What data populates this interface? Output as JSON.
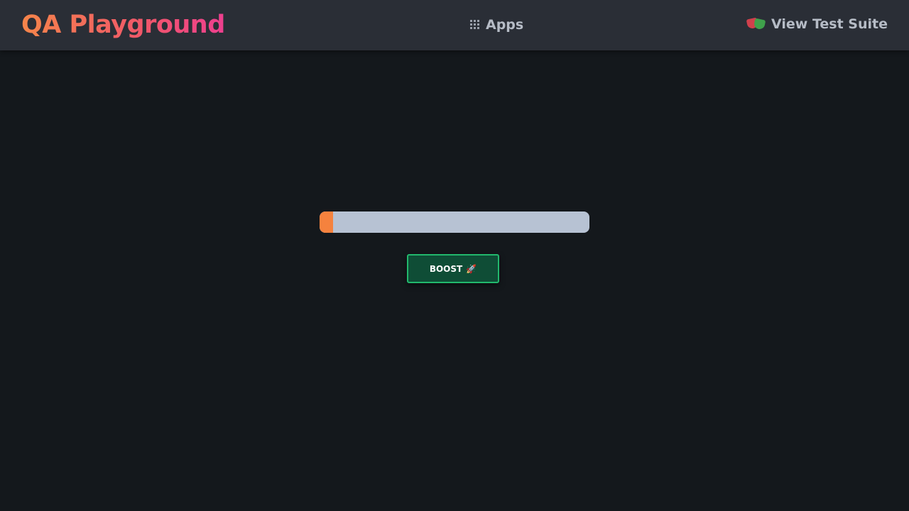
{
  "header": {
    "brand": "QA Playground",
    "apps_label": "Apps",
    "apps_icon": "grid-icon",
    "test_suite_label": "View Test Suite",
    "test_suite_icon": "theater-masks-icon"
  },
  "main": {
    "progress": {
      "value_percent": 5,
      "fill_color": "#f5823e",
      "track_color": "#b7c2d3"
    },
    "boost_button": {
      "label": "BOOST",
      "icon": "rocket-icon",
      "icon_glyph": "🚀"
    }
  },
  "colors": {
    "background": "#14181c",
    "navbar": "#2a2e36",
    "brand_gradient_start": "#f5854a",
    "brand_gradient_end": "#ee3f8f",
    "button_bg": "#0f4d36",
    "button_border": "#22b86d"
  }
}
